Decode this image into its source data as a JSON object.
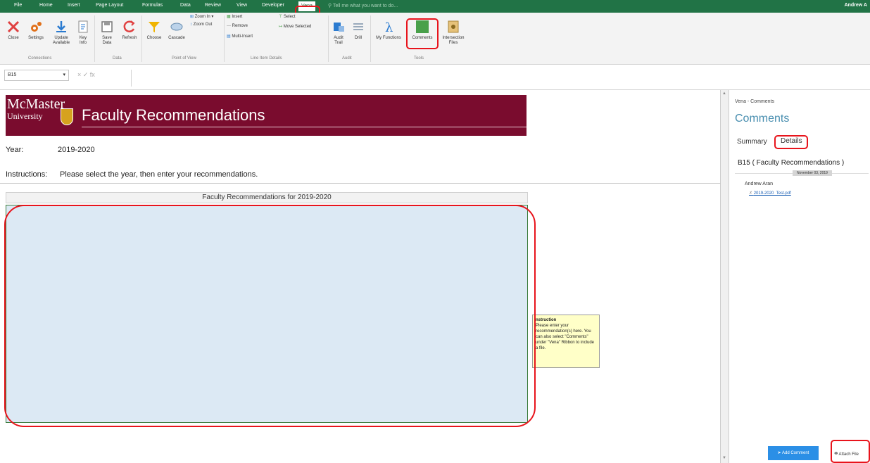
{
  "tabs": [
    "File",
    "Home",
    "Insert",
    "Page Layout",
    "Formulas",
    "Data",
    "Review",
    "View",
    "Developer",
    "Vena"
  ],
  "tell_me": "Tell me what you want to do...",
  "user": "Andrew A",
  "ribbon": {
    "connections": {
      "label": "Connections",
      "close": "Close",
      "settings": "Settings",
      "update": "Update Available",
      "key": "Key Info"
    },
    "data": {
      "label": "Data",
      "save": "Save Data",
      "refresh": "Refresh"
    },
    "pov": {
      "label": "Point of View",
      "choose": "Choose",
      "cascade": "Cascade",
      "zoom_in": "Zoom In",
      "zoom_out": "Zoom Out"
    },
    "lid": {
      "label": "Line Item Details",
      "insert": "Insert",
      "remove": "Remove",
      "multi": "Multi-Insert",
      "select": "Select",
      "move": "Move Selected"
    },
    "audit": {
      "label": "Audit",
      "trail": "Audit Trail",
      "drill": "Drill"
    },
    "tools": {
      "label": "Tools",
      "functions": "My Functions",
      "comments": "Comments",
      "intersection": "Intersection Files"
    }
  },
  "formula_bar": {
    "cell": "B15",
    "icons": "×  ✓  fx"
  },
  "sheet": {
    "logo_line1": "McMaster",
    "logo_line2": "University",
    "title": "Faculty Recommendations",
    "year_label": "Year:",
    "year_value": "2019-2020",
    "instructions_label": "Instructions:",
    "instructions_text": "Please select the year, then enter your recommendations.",
    "table_header": "Faculty Recommendations for 2019-2020",
    "note_title": "nstruction",
    "note_text": "Please enter your recommendation(s) here. You can also select \"Comments\" under \"Vena\" Ribbon to include a file."
  },
  "pane": {
    "title": "Vena - Comments",
    "heading": "Comments",
    "tab_summary": "Summary",
    "tab_details": "Details",
    "cell_ref": "B15  ( Faculty Recommendations )",
    "date": "November 03, 2019",
    "author": "Andrew Aran",
    "attachment": "2019-2020_Test.pdf",
    "add_comment": "Add Comment",
    "attach_file": "Attach File"
  },
  "colors": {
    "excel_green": "#217346",
    "mcmaster_maroon": "#7a0c2e",
    "entry_blue": "#dce9f4",
    "highlight_red": "#e8141c"
  }
}
